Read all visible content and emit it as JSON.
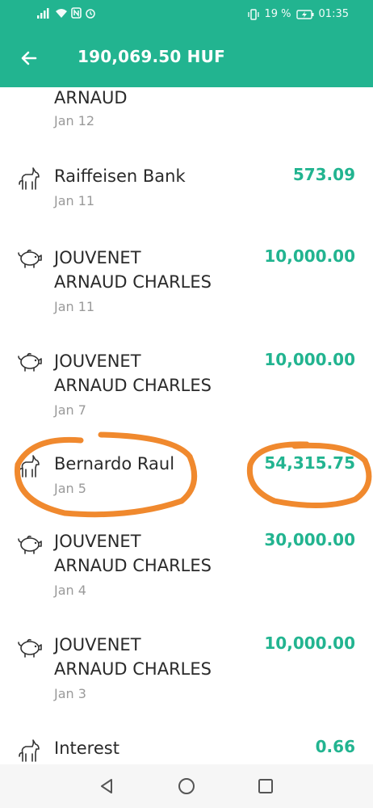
{
  "status_bar": {
    "battery_percent": "19 %",
    "time": "01:35"
  },
  "header": {
    "title": "190,069.50 HUF"
  },
  "transactions": [
    {
      "name_line1": "",
      "name_line2": "ARNAUD",
      "date": "Jan 12",
      "amount": "",
      "icon": "unicorn-icon"
    },
    {
      "name_line1": "Raiffeisen Bank",
      "name_line2": "",
      "date": "Jan 11",
      "amount": "573.09",
      "icon": "unicorn-icon"
    },
    {
      "name_line1": "JOUVENET",
      "name_line2": "ARNAUD CHARLES",
      "date": "Jan 11",
      "amount": "10,000.00",
      "icon": "piggy-bank-icon"
    },
    {
      "name_line1": "JOUVENET",
      "name_line2": "ARNAUD CHARLES",
      "date": "Jan 7",
      "amount": "10,000.00",
      "icon": "piggy-bank-icon"
    },
    {
      "name_line1": "Bernardo Raul",
      "name_line2": "",
      "date": "Jan 5",
      "amount": "54,315.75",
      "icon": "unicorn-icon"
    },
    {
      "name_line1": "JOUVENET",
      "name_line2": "ARNAUD CHARLES",
      "date": "Jan 4",
      "amount": "30,000.00",
      "icon": "piggy-bank-icon"
    },
    {
      "name_line1": "JOUVENET",
      "name_line2": "ARNAUD CHARLES",
      "date": "Jan 3",
      "amount": "10,000.00",
      "icon": "piggy-bank-icon"
    },
    {
      "name_line1": "Interest",
      "name_line2": "",
      "date": "",
      "amount": "0.66",
      "icon": "unicorn-icon"
    }
  ],
  "colors": {
    "accent": "#22b490",
    "annotation": "#f0892e"
  }
}
